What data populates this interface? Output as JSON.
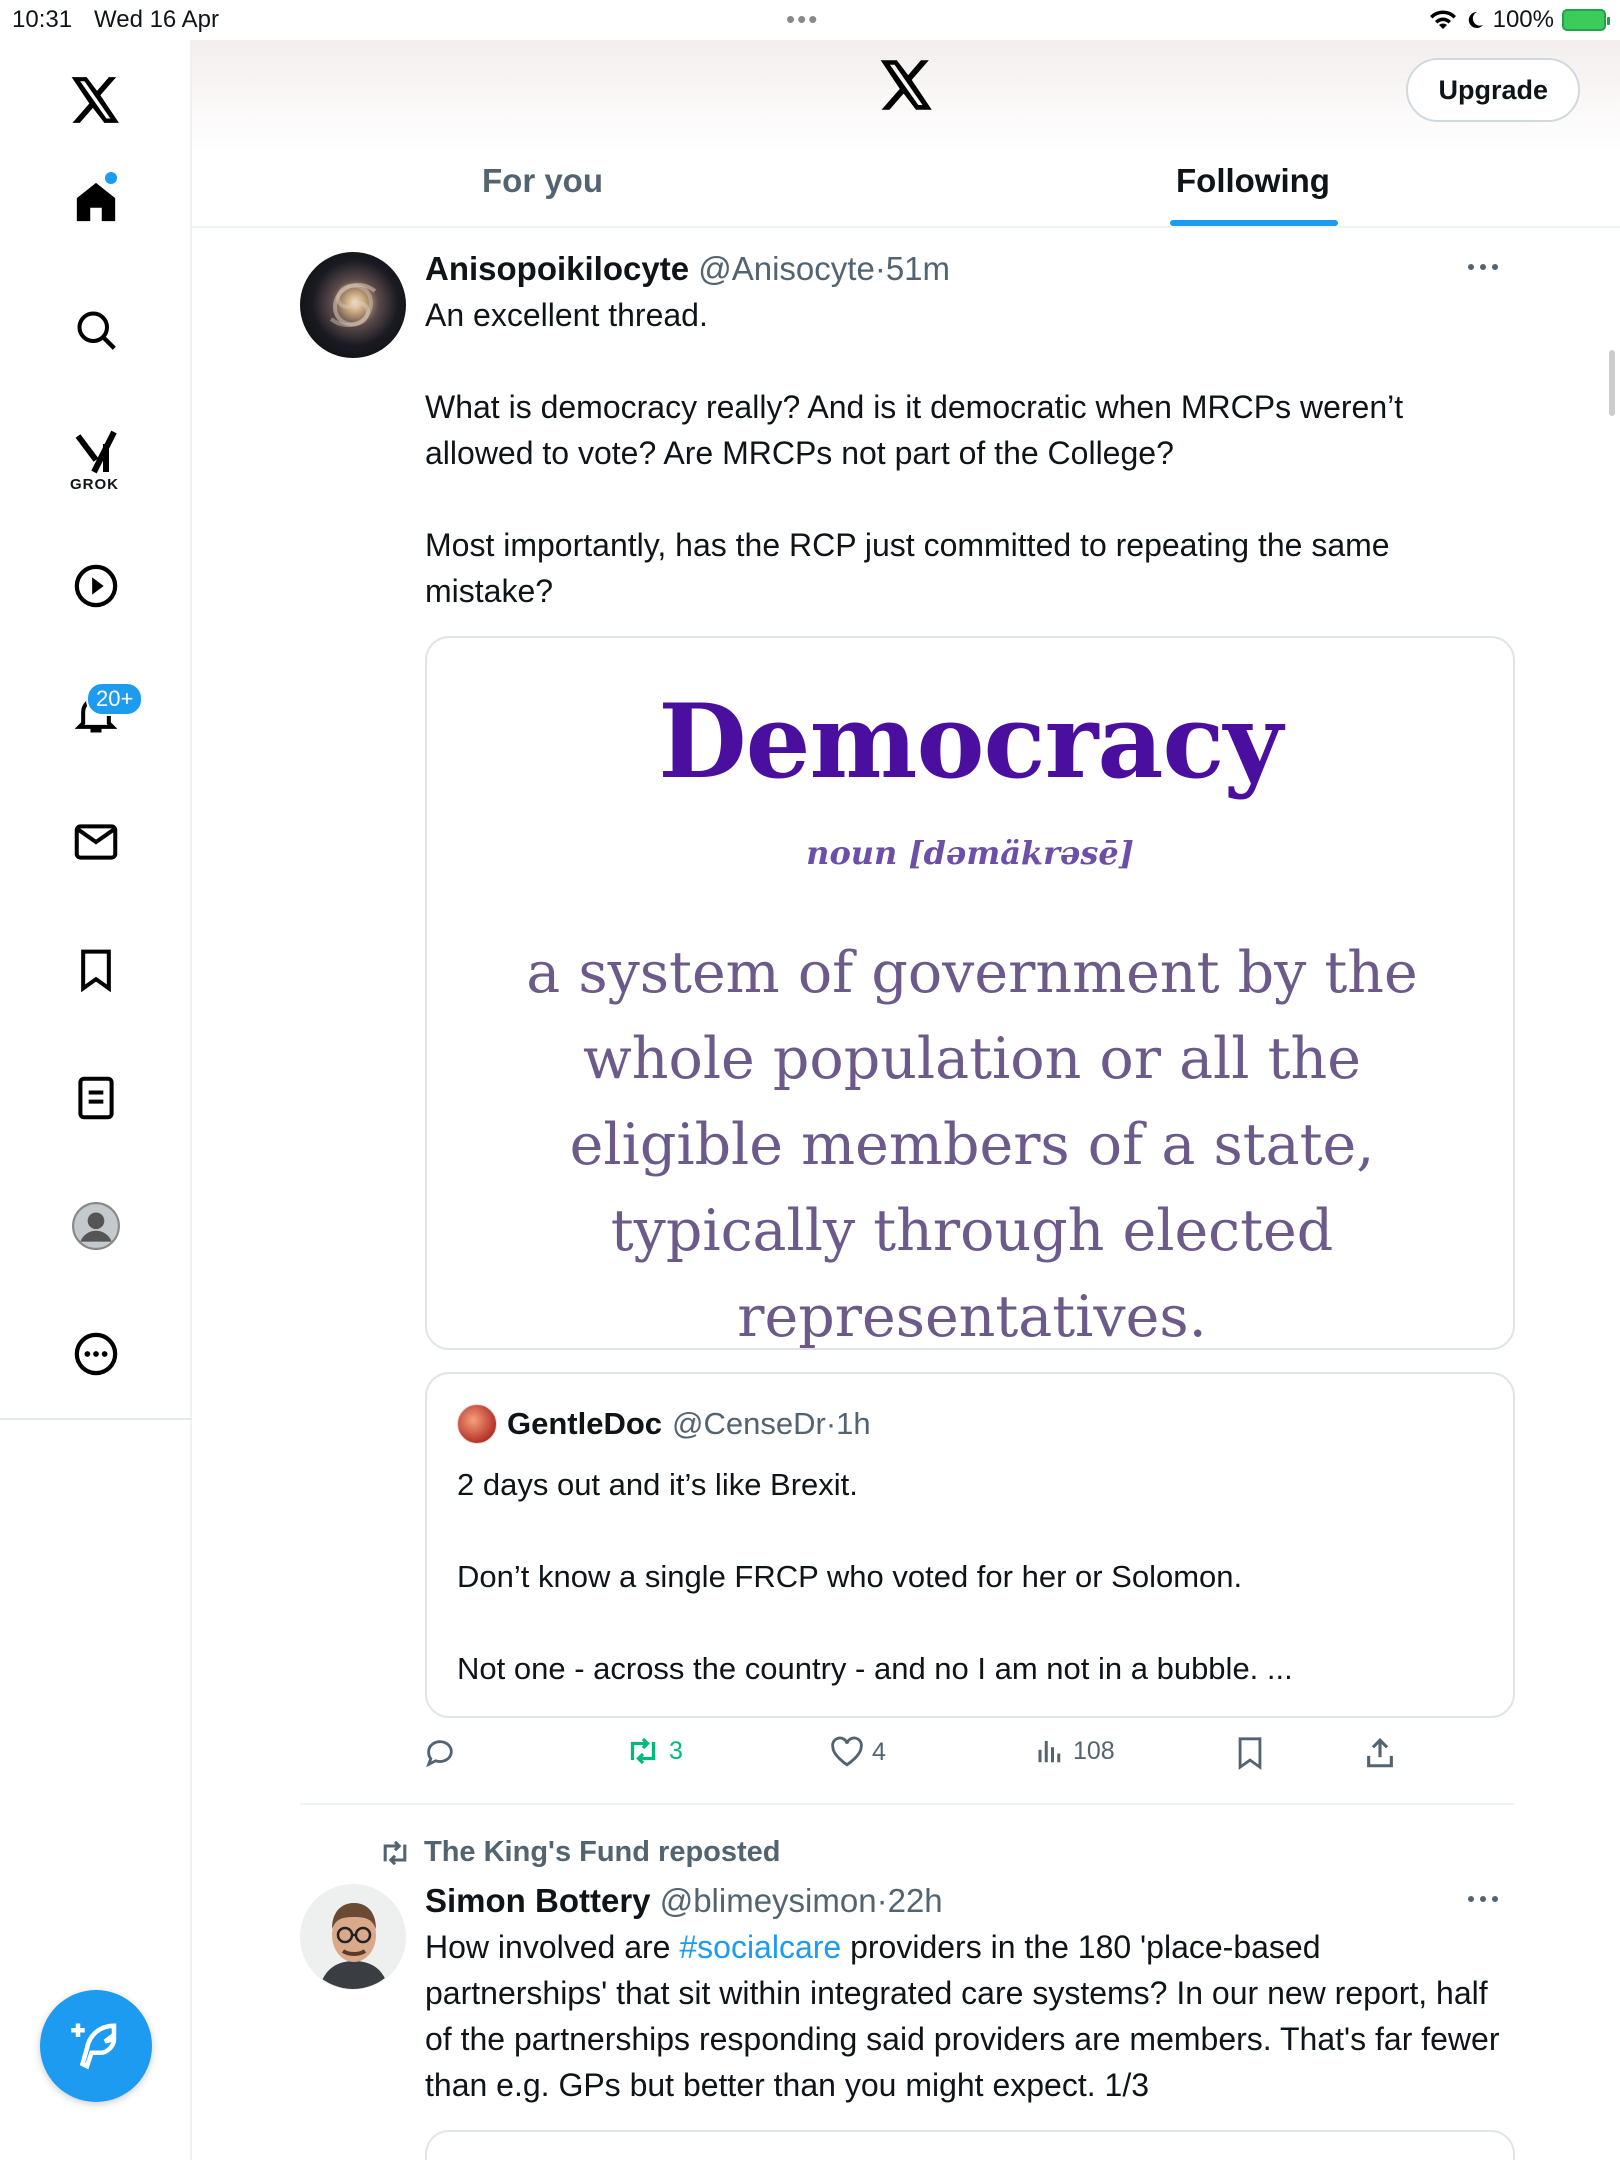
{
  "status_bar": {
    "time": "10:31",
    "date": "Wed 16 Apr",
    "battery": "100%"
  },
  "sidebar": {
    "grok_label": "GROK",
    "notifications_badge": "20+",
    "items": [
      "home-icon",
      "search-icon",
      "grok-icon",
      "video-icon",
      "notifications-icon",
      "messages-icon",
      "bookmarks-icon",
      "lists-icon",
      "profile-icon",
      "more-icon"
    ]
  },
  "header": {
    "upgrade_label": "Upgrade",
    "tabs": [
      {
        "label": "For you"
      },
      {
        "label": "Following"
      }
    ],
    "active_tab": "Following"
  },
  "posts": [
    {
      "name": "Anisopoikilocyte",
      "handle": "@Anisocyte",
      "time": "51m",
      "text": "An excellent thread.\n\nWhat is democracy really? And is it democratic when MRCPs weren’t allowed to vote? Are MRCPs not part of the College?\n\nMost importantly, has the RCP just committed to repeating the same mistake?",
      "image": {
        "title": "Democracy",
        "pronunciation": "noun [dəmäkrəsē]",
        "definition": "a system of government by the\nwhole population or all the\neligible members of a state,\ntypically through elected\nrepresentatives."
      },
      "quote": {
        "name": "GentleDoc",
        "handle": "@CenseDr",
        "time": "1h",
        "text": "2 days out and it’s like Brexit.\n\nDon’t know a single FRCP who voted for her or Solomon.\n\nNot one - across the country - and no I am not in a bubble. ..."
      },
      "stats": {
        "replies": "",
        "reposts": "3",
        "likes": "4",
        "views": "108"
      }
    },
    {
      "reposted_by": "The King's Fund reposted",
      "name": "Simon Bottery",
      "handle": "@blimeysimon",
      "time": "22h",
      "text_before": "How involved are ",
      "hashtag": "#socialcare",
      "text_after": " providers in the 180 'place-based partnerships' that sit within integrated care systems? In our new report, half of the partnerships responding said providers are members. That's far fewer than e.g. GPs but better than you might expect. 1/3"
    }
  ],
  "colors": {
    "accent": "#1d9bf0",
    "repost_green": "#00ba7c",
    "muted": "#536471",
    "democracy_purple": "#4b0fa0"
  }
}
